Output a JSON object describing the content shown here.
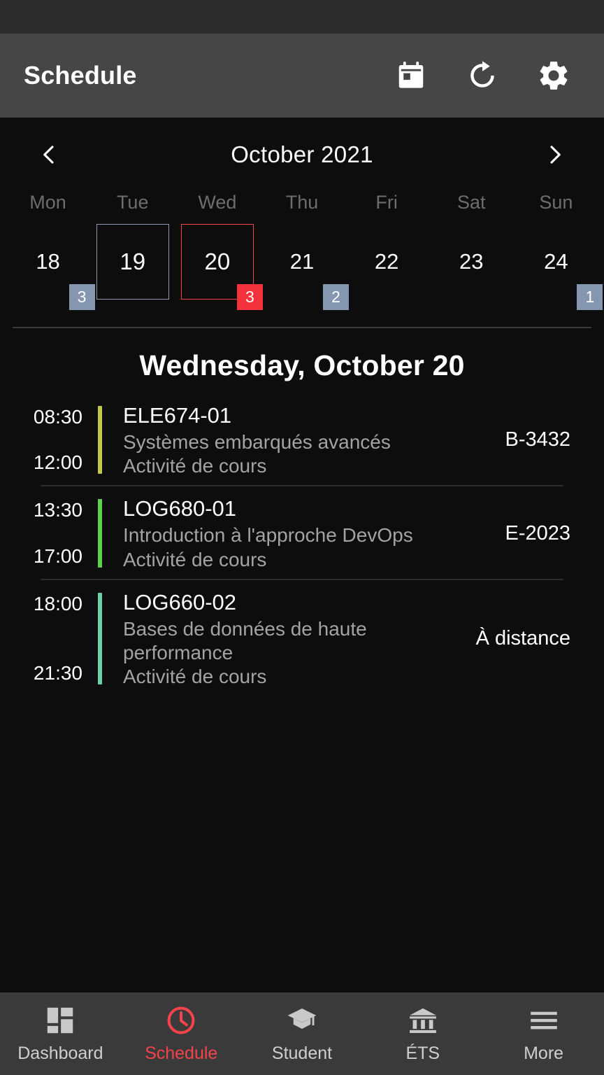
{
  "appbar": {
    "title": "Schedule",
    "actions": [
      {
        "name": "today-icon",
        "label": "Today"
      },
      {
        "name": "refresh-icon",
        "label": "Refresh"
      },
      {
        "name": "settings-icon",
        "label": "Settings"
      }
    ]
  },
  "calendar": {
    "month": "October 2021",
    "prev_label": "‹",
    "next_label": "›",
    "day_names": [
      "Mon",
      "Tue",
      "Wed",
      "Thu",
      "Fri",
      "Sat",
      "Sun"
    ],
    "days": [
      {
        "num": "18",
        "badge": "3",
        "badge_color": "blue",
        "state": "plain"
      },
      {
        "num": "19",
        "badge": "",
        "badge_color": "",
        "state": "sel-blue"
      },
      {
        "num": "20",
        "badge": "3",
        "badge_color": "red",
        "state": "sel-red"
      },
      {
        "num": "21",
        "badge": "2",
        "badge_color": "blue",
        "state": "plain"
      },
      {
        "num": "22",
        "badge": "",
        "badge_color": "",
        "state": "plain"
      },
      {
        "num": "23",
        "badge": "",
        "badge_color": "",
        "state": "plain"
      },
      {
        "num": "24",
        "badge": "1",
        "badge_color": "blue",
        "state": "plain"
      }
    ],
    "badge_colors": {
      "blue": "#8496b0",
      "red": "#f4323c"
    },
    "selected_outline": "#f4434b",
    "today_outline": "#8b9cb4"
  },
  "day_title": "Wednesday, October 20",
  "events": [
    {
      "start": "08:30",
      "end": "12:00",
      "code": "ELE674-01",
      "name": "Systèmes embarqués avancés",
      "kind": "Activité de cours",
      "location": "B-3432",
      "color": "#c3c84b"
    },
    {
      "start": "13:30",
      "end": "17:00",
      "code": "LOG680-01",
      "name": "Introduction à l'approche DevOps",
      "kind": "Activité de cours",
      "location": "E-2023",
      "color": "#5ed14e"
    },
    {
      "start": "18:00",
      "end": "21:30",
      "code": "LOG660-02",
      "name": "Bases de données de haute performance",
      "kind": "Activité de cours",
      "location": "À distance",
      "color": "#6ecfa8"
    }
  ],
  "bottomnav": {
    "active_color": "#f4434b",
    "items": [
      {
        "label": "Dashboard",
        "icon": "dashboard-grid-icon",
        "active": false
      },
      {
        "label": "Schedule",
        "icon": "clock-icon",
        "active": true
      },
      {
        "label": "Student",
        "icon": "graduation-cap-icon",
        "active": false
      },
      {
        "label": "ÉTS",
        "icon": "bank-icon",
        "active": false
      },
      {
        "label": "More",
        "icon": "hamburger-menu-icon",
        "active": false
      }
    ]
  }
}
